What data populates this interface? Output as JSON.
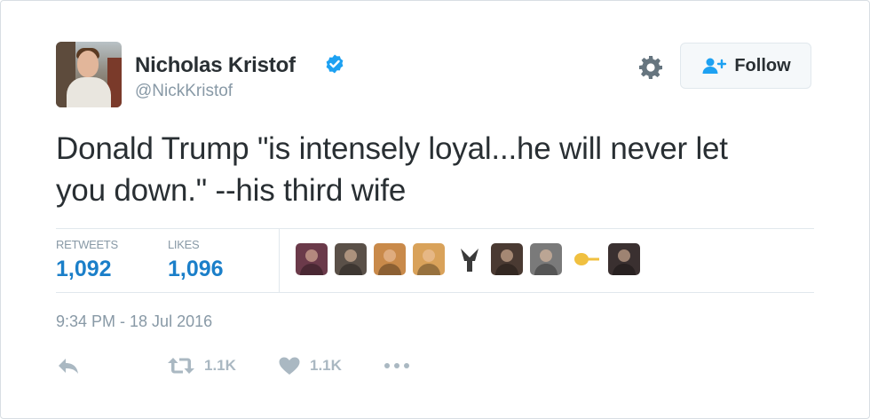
{
  "author": {
    "name": "Nicholas Kristof",
    "handle": "@NickKristof",
    "verified": true
  },
  "follow_button": {
    "label": "Follow"
  },
  "tweet": {
    "text_line1": "Donald Trump \"is intensely loyal...he will never let",
    "text_line2": "you down.\" --his third wife"
  },
  "stats": {
    "retweets_label": "RETWEETS",
    "retweets_value": "1,092",
    "likes_label": "LIKES",
    "likes_value": "1,096"
  },
  "likers": [
    {
      "color": "#6b3a4a"
    },
    {
      "color": "#5a5048"
    },
    {
      "color": "#c98a4a"
    },
    {
      "color": "#d9a25a"
    },
    {
      "color": "#ffffff"
    },
    {
      "color": "#4a3a32"
    },
    {
      "color": "#7a7a7a"
    },
    {
      "color": "#f0c040"
    },
    {
      "color": "#3a3030"
    }
  ],
  "timestamp": "9:34 PM - 18 Jul 2016",
  "actions": {
    "retweet_count": "1.1K",
    "like_count": "1.1K"
  },
  "colors": {
    "link_blue": "#1b7fc9",
    "muted": "#8899a6",
    "verified": "#1da1f2",
    "action_gray": "#aab8c2"
  },
  "icons": [
    "verified-badge-icon",
    "gear-icon",
    "follow-person-icon",
    "reply-icon",
    "retweet-icon",
    "heart-icon",
    "more-dots-icon"
  ]
}
